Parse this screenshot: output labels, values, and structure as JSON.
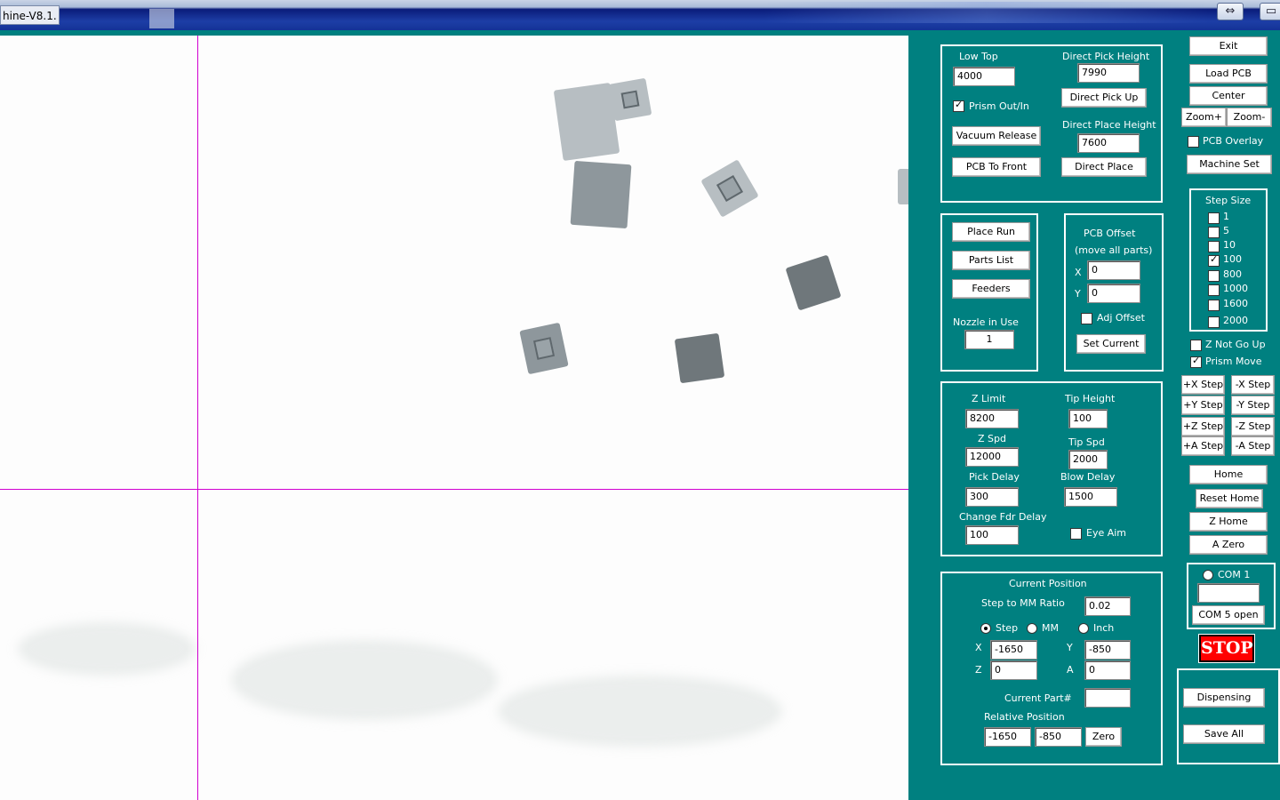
{
  "window": {
    "title": "hine-V8.1.",
    "restore_symbol": "⇔",
    "close_symbol": "▭"
  },
  "height_group": {
    "low_top_label": "Low Top",
    "low_top_value": "4000",
    "prism_label": "Prism Out/In",
    "prism_checked": true,
    "vacuum_release": "Vacuum Release",
    "pcb_to_front": "PCB To Front",
    "direct_pick_height_label": "Direct Pick Height",
    "direct_pick_height_value": "7990",
    "direct_pick_up": "Direct Pick Up",
    "direct_place_height_label": "Direct Place Height",
    "direct_place_height_value": "7600",
    "direct_place": "Direct Place"
  },
  "run_group": {
    "place_run": "Place Run",
    "parts_list": "Parts List",
    "feeders": "Feeders",
    "nozzle_label": "Nozzle in Use",
    "nozzle_value": "1"
  },
  "offset_group": {
    "title1": "PCB Offset",
    "title2": "(move all parts)",
    "x_label": "X",
    "x_value": "0",
    "y_label": "Y",
    "y_value": "0",
    "adj_offset_label": "Adj Offset",
    "adj_offset_checked": false,
    "set_current": "Set Current"
  },
  "params_group": {
    "z_limit_label": "Z Limit",
    "z_limit_value": "8200",
    "tip_height_label": "Tip Height",
    "tip_height_value": "100",
    "z_spd_label": "Z Spd",
    "z_spd_value": "12000",
    "tip_spd_label": "Tip Spd",
    "tip_spd_value": "2000",
    "pick_delay_label": "Pick Delay",
    "pick_delay_value": "300",
    "blow_delay_label": "Blow Delay",
    "blow_delay_value": "1500",
    "change_fdr_delay_label": "Change Fdr Delay",
    "change_fdr_delay_value": "100",
    "eye_aim_label": "Eye Aim",
    "eye_aim_checked": false
  },
  "position_group": {
    "title": "Current Position",
    "ratio_label": "Step to MM Ratio",
    "ratio_value": "0.02",
    "unit_step": "Step",
    "unit_mm": "MM",
    "unit_inch": "Inch",
    "selected_unit": "Step",
    "x_label": "X",
    "x_value": "-1650",
    "y_label": "Y",
    "y_value": "-850",
    "z_label": "Z",
    "z_value": "0",
    "a_label": "A",
    "a_value": "0",
    "current_part_label": "Current Part#",
    "current_part_value": "",
    "relative_label": "Relative Position",
    "rel_x_value": "-1650",
    "rel_y_value": "-850",
    "zero_button": "Zero"
  },
  "right_panel": {
    "exit": "Exit",
    "load_pcb": "Load PCB",
    "center": "Center",
    "zoom_in": "Zoom+",
    "zoom_out": "Zoom-",
    "pcb_overlay_label": "PCB Overlay",
    "pcb_overlay_checked": false,
    "machine_set": "Machine Set",
    "step_size_title": "Step Size",
    "step_sizes": [
      {
        "label": "1",
        "checked": false
      },
      {
        "label": "5",
        "checked": false
      },
      {
        "label": "10",
        "checked": false
      },
      {
        "label": "100",
        "checked": true
      },
      {
        "label": "800",
        "checked": false
      },
      {
        "label": "1000",
        "checked": false
      },
      {
        "label": "1600",
        "checked": false
      },
      {
        "label": "2000",
        "checked": false
      }
    ],
    "z_not_go_up_label": "Z Not Go Up",
    "z_not_go_up_checked": false,
    "prism_move_label": "Prism Move",
    "prism_move_checked": true,
    "x_plus": "+X Step",
    "x_minus": "-X Step",
    "y_plus": "+Y Step",
    "y_minus": "-Y Step",
    "z_plus": "+Z Step",
    "z_minus": "-Z Step",
    "a_plus": "+A Step",
    "a_minus": "-A Step",
    "home": "Home",
    "reset_home": "Reset Home",
    "z_home": "Z Home",
    "a_zero": "A Zero",
    "com_label": "COM 1",
    "com_value": "",
    "com_status": "COM 5 open",
    "stop": "STOP",
    "dispensing": "Dispensing",
    "save_all": "Save All"
  },
  "colors": {
    "panel_background": "#008080",
    "crosshair": "#d000d0",
    "stop_button": "#ff0000"
  }
}
